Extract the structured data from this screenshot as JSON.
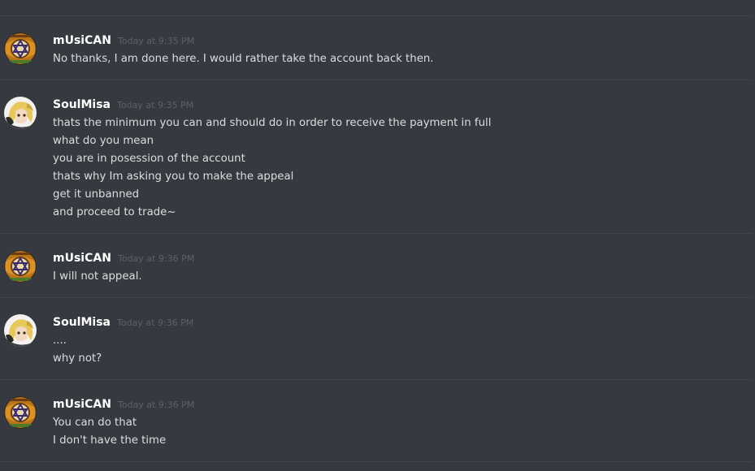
{
  "messages": [
    {
      "author": "mUsiCAN",
      "avatar": "mUsiCAN-avatar-icon",
      "timestamp": "Today at 9:35 PM",
      "lines": [
        "No thanks, I am done here. I would rather take the account back then."
      ]
    },
    {
      "author": "SoulMisa",
      "avatar": "SoulMisa-avatar-icon",
      "timestamp": "Today at 9:35 PM",
      "lines": [
        "thats the minimum you can and should do in order to receive the payment in full",
        "what do you mean",
        "you are in posession of the account",
        "thats why Im asking you to make the appeal",
        "get it unbanned",
        "and proceed to trade~"
      ]
    },
    {
      "author": "mUsiCAN",
      "avatar": "mUsiCAN-avatar-icon",
      "timestamp": "Today at 9:36 PM",
      "lines": [
        "I will not appeal."
      ]
    },
    {
      "author": "SoulMisa",
      "avatar": "SoulMisa-avatar-icon",
      "timestamp": "Today at 9:36 PM",
      "lines": [
        "....",
        "why not?"
      ]
    },
    {
      "author": "mUsiCAN",
      "avatar": "mUsiCAN-avatar-icon",
      "timestamp": "Today at 9:36 PM",
      "lines": [
        "You can do that",
        "I don't have the time"
      ]
    }
  ],
  "colors": {
    "background": "#36393f",
    "divider": "#40444b",
    "username": "#ffffff",
    "timestamp": "#5d6066",
    "text": "#dcddde"
  }
}
